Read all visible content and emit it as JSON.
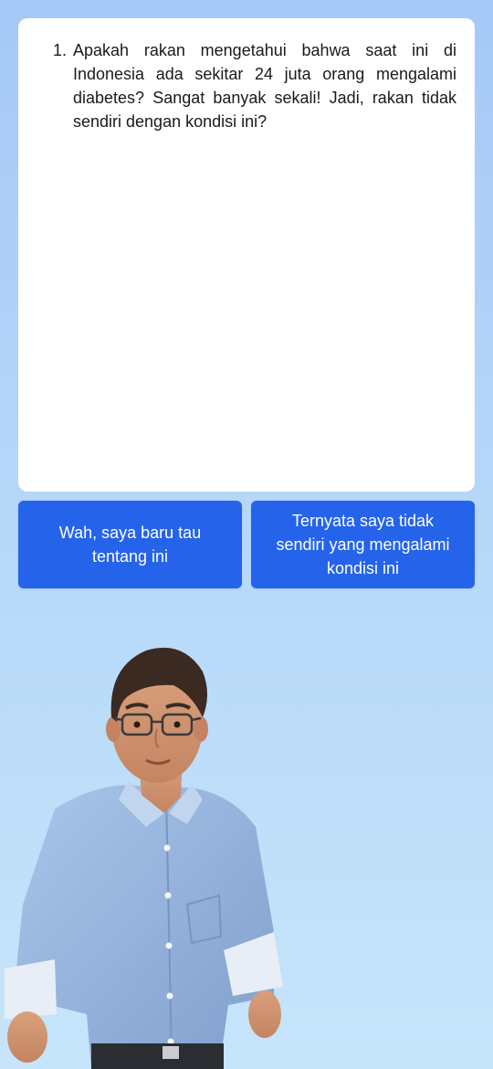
{
  "question": {
    "number": "1.",
    "text": "Apakah rakan mengetahui bahwa saat ini di Indonesia ada sekitar 24 juta orang mengalami diabetes? Sangat banyak sekali! Jadi, rakan tidak sendiri dengan kondisi ini?"
  },
  "answers": [
    {
      "label": "Wah, saya baru tau tentang ini"
    },
    {
      "label": "Ternyata saya tidak sendiri yang mengalami kondisi ini"
    }
  ],
  "avatar": {
    "icon": "avatar-person-illustration"
  },
  "colors": {
    "primary_button": "#2563eb",
    "card": "#ffffff",
    "background_top": "#a6c8f7",
    "background_bottom": "#c6e5fb"
  }
}
